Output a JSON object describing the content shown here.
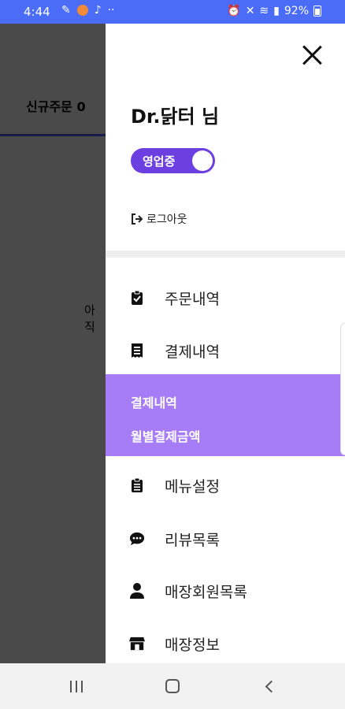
{
  "status_bar": {
    "time": "4:44",
    "battery": "92%"
  },
  "background": {
    "tab_label": "신규주문 0",
    "partial_text": "아직"
  },
  "drawer": {
    "user_name": "Dr.닭터 님",
    "status_toggle": {
      "label": "영업중",
      "on": true
    },
    "logout_label": "로그아웃",
    "menu": [
      {
        "label": "주문내역",
        "icon": "clipboard-check-icon"
      },
      {
        "label": "결제내역",
        "icon": "receipt-icon"
      },
      {
        "label": "메뉴설정",
        "icon": "clipboard-list-icon"
      },
      {
        "label": "리뷰목록",
        "icon": "chat-bubble-icon"
      },
      {
        "label": "매장회원목록",
        "icon": "user-icon"
      },
      {
        "label": "매장정보",
        "icon": "store-icon"
      }
    ],
    "submenu": [
      {
        "label": "결제내역"
      },
      {
        "label": "월별결제금액"
      }
    ]
  },
  "colors": {
    "accent": "#6b3fe0",
    "submenu_bg": "#a67cf7",
    "status_bar": "#4a6cf7"
  }
}
